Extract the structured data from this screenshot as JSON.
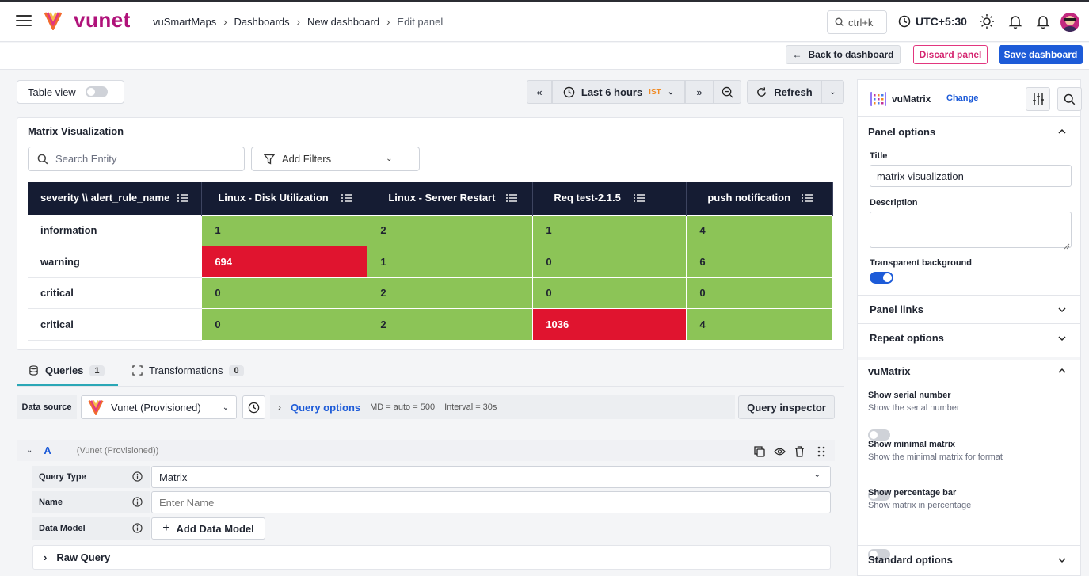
{
  "brand": {
    "name": "vunet",
    "color": "#b0127a"
  },
  "breadcrumb": [
    "vuSmartMaps",
    "Dashboards",
    "New dashboard",
    "Edit panel"
  ],
  "topbar": {
    "search_placeholder": "ctrl+k",
    "timezone": "UTC+5:30"
  },
  "actions": {
    "back": "Back to dashboard",
    "discard": "Discard panel",
    "save": "Save dashboard"
  },
  "toolbar": {
    "table_view": "Table view",
    "time_range": "Last 6 hours",
    "tz_badge": "IST",
    "refresh": "Refresh"
  },
  "panel": {
    "title": "Matrix Visualization",
    "search_placeholder": "Search Entity",
    "filters_label": "Add Filters",
    "columns": [
      "severity \\\\ alert_rule_name",
      "Linux - Disk Utilization",
      "Linux - Server Restart",
      "Req test-2.1.5",
      "push notification"
    ],
    "rows": [
      {
        "label": "information",
        "cells": [
          "1",
          "2",
          "1",
          "4"
        ],
        "status": [
          "green",
          "green",
          "green",
          "green"
        ]
      },
      {
        "label": "warning",
        "cells": [
          "694",
          "1",
          "0",
          "6"
        ],
        "status": [
          "red",
          "green",
          "green",
          "green"
        ]
      },
      {
        "label": "critical",
        "cells": [
          "0",
          "2",
          "0",
          "0"
        ],
        "status": [
          "green",
          "green",
          "green",
          "green"
        ]
      },
      {
        "label": "critical",
        "cells": [
          "0",
          "2",
          "1036",
          "4"
        ],
        "status": [
          "green",
          "green",
          "red",
          "green"
        ]
      }
    ],
    "colors": {
      "ok": "#8cc457",
      "alert": "#e0142f",
      "header": "#151c33"
    }
  },
  "tabs": {
    "queries": "Queries",
    "queries_count": "1",
    "transformations": "Transformations",
    "transformations_count": "0"
  },
  "datasource": {
    "label": "Data source",
    "value": "Vunet (Provisioned)",
    "query_options": "Query options",
    "md": "MD = auto = 500",
    "interval": "Interval = 30s",
    "inspector": "Query inspector"
  },
  "query": {
    "letter": "A",
    "source": "(Vunet (Provisioned))",
    "type_label": "Query Type",
    "type_value": "Matrix",
    "name_label": "Name",
    "name_placeholder": "Enter Name",
    "model_label": "Data Model",
    "model_button": "Add Data Model",
    "raw_query": "Raw Query"
  },
  "options": {
    "viz_name": "vuMatrix",
    "change": "Change",
    "panel_options": "Panel options",
    "title_label": "Title",
    "title_value": "matrix visualization",
    "description_label": "Description",
    "transparent_label": "Transparent background",
    "transparent_on": true,
    "panel_links": "Panel links",
    "repeat_options": "Repeat options",
    "vumatrix_section": "vuMatrix",
    "serial_label": "Show serial number",
    "serial_desc": "Show the serial number",
    "minimal_label": "Show minimal matrix",
    "minimal_desc": "Show the minimal matrix for format",
    "percent_label": "Show percentage bar",
    "percent_desc": "Show matrix in percentage",
    "standard_options": "Standard options"
  }
}
